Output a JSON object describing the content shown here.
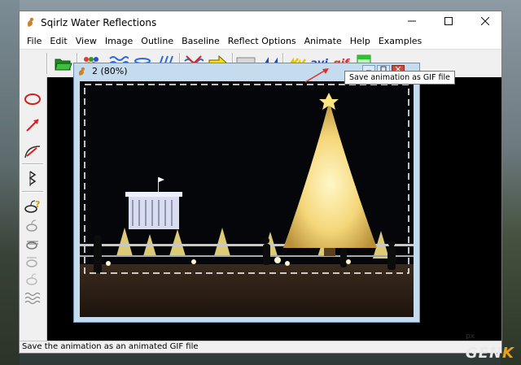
{
  "window": {
    "title": "Sqirlz Water Reflections"
  },
  "menu": [
    "File",
    "Edit",
    "View",
    "Image",
    "Outline",
    "Baseline",
    "Reflect Options",
    "Animate",
    "Help",
    "Examples"
  ],
  "toolbar": {
    "avi_label": "avi",
    "gif_label": "gif"
  },
  "tooltip": {
    "text": "Save animation as GIF file"
  },
  "child": {
    "title": "2  (80%)"
  },
  "status": {
    "text": "Save the animation as an animated GIF file"
  },
  "corner_label": "px",
  "watermark": {
    "main": "GEN",
    "accent": "K"
  },
  "colors": {
    "gif_red": "#d93030",
    "avi_blue": "#1c44c8",
    "tooltip_arrow": "#e03030"
  }
}
